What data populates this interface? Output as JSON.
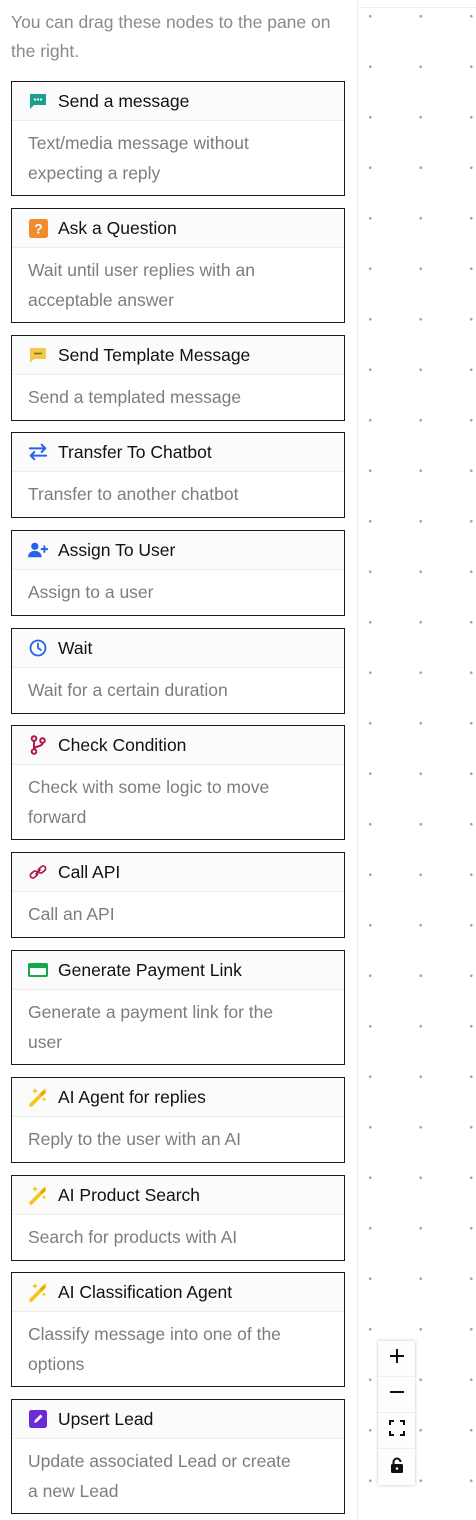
{
  "sidebar": {
    "hint": "You can drag these nodes to the pane on the right.",
    "nodes": [
      {
        "title": "Send a message",
        "desc": "Text/media message without expecting a reply",
        "icon": "message-icon",
        "color": "#1aa08c"
      },
      {
        "title": "Ask a Question",
        "desc": "Wait until user replies with an acceptable answer",
        "icon": "question-icon",
        "color": "#f28b30"
      },
      {
        "title": "Send Template Message",
        "desc": "Send a templated message",
        "icon": "template-icon",
        "color": "#f2c94c"
      },
      {
        "title": "Transfer To Chatbot",
        "desc": "Transfer to another chatbot",
        "icon": "transfer-icon",
        "color": "#2563eb"
      },
      {
        "title": "Assign To User",
        "desc": "Assign to a user",
        "icon": "assign-user-icon",
        "color": "#2563eb"
      },
      {
        "title": "Wait",
        "desc": "Wait for a certain duration",
        "icon": "clock-icon",
        "color": "#2563eb"
      },
      {
        "title": "Check Condition",
        "desc": "Check with some logic to move forward",
        "icon": "branch-icon",
        "color": "#b0184f"
      },
      {
        "title": "Call API",
        "desc": "Call an API",
        "icon": "link-icon",
        "color": "#b0184f"
      },
      {
        "title": "Generate Payment Link",
        "desc": "Generate a payment link for the user",
        "icon": "credit-card-icon",
        "color": "#14a84a"
      },
      {
        "title": "AI Agent for replies",
        "desc": "Reply to the user with an AI",
        "icon": "magic-wand-icon",
        "color": "#f5c518"
      },
      {
        "title": "AI Product Search",
        "desc": "Search for products with AI",
        "icon": "magic-wand-icon",
        "color": "#f5c518"
      },
      {
        "title": "AI Classification Agent",
        "desc": "Classify message into one of the options",
        "icon": "magic-wand-icon",
        "color": "#f5c518"
      },
      {
        "title": "Upsert Lead",
        "desc": "Update associated Lead or create a new Lead",
        "icon": "edit-icon",
        "color": "#6d28d9"
      }
    ]
  },
  "canvas": {
    "controls": [
      {
        "name": "zoom-in-button",
        "icon": "plus-icon"
      },
      {
        "name": "zoom-out-button",
        "icon": "minus-icon"
      },
      {
        "name": "fit-view-button",
        "icon": "fit-view-icon"
      },
      {
        "name": "lock-button",
        "icon": "lock-icon"
      }
    ]
  }
}
